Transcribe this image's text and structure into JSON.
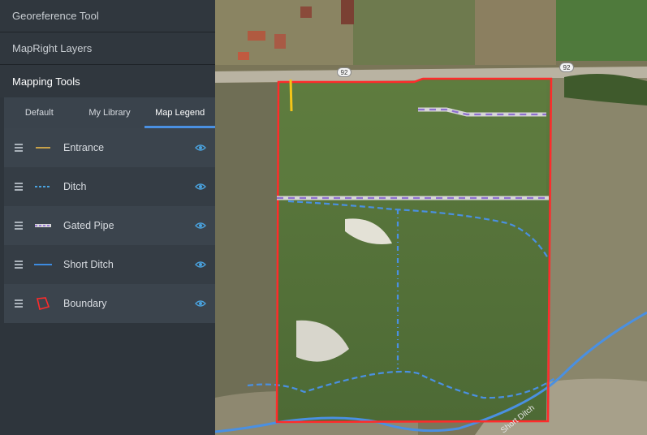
{
  "sidebar": {
    "sections": [
      {
        "label": "Georeference Tool"
      },
      {
        "label": "MapRight Layers"
      },
      {
        "label": "Mapping Tools"
      }
    ],
    "tabs": [
      {
        "label": "Default"
      },
      {
        "label": "My Library"
      },
      {
        "label": "Map Legend"
      }
    ],
    "active_tab": "Map Legend",
    "legend": [
      {
        "label": "Entrance",
        "icon": "solid-line-icon",
        "color": "#c8a24a"
      },
      {
        "label": "Ditch",
        "icon": "dashed-line-icon",
        "color": "#4aa3df"
      },
      {
        "label": "Gated Pipe",
        "icon": "gated-pipe-icon",
        "color": "#9a7bd6"
      },
      {
        "label": "Short Ditch",
        "icon": "solid-line-icon",
        "color": "#3d8be0"
      },
      {
        "label": "Boundary",
        "icon": "polygon-icon",
        "color": "#ff2b2b"
      }
    ]
  },
  "map": {
    "road_shields": [
      "92",
      "92"
    ],
    "road_label": "Short Ditch"
  }
}
